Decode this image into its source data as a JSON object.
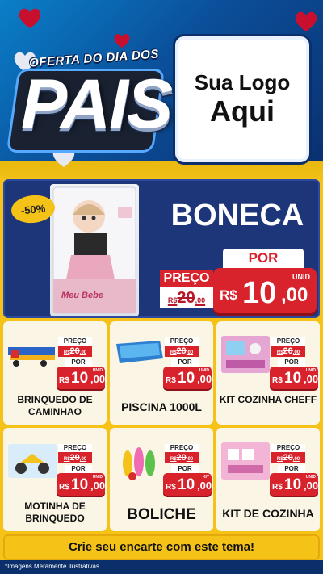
{
  "header": {
    "brand_subtitle": "OFERTA DO DIA DOS",
    "brand_main": "PAIS",
    "logo_line1": "Sua Logo",
    "logo_line2": "Aqui"
  },
  "hero": {
    "discount": "-50%",
    "product_box_text": "Meu Bebe",
    "title": "BONECA",
    "por_label": "POR",
    "preco_label": "PREÇO",
    "old_currency": "R$",
    "old_int": "20",
    "old_dec": ",00",
    "new_currency": "R$",
    "new_int": "10",
    "new_dec": ",00",
    "unit": "UNID"
  },
  "products": [
    {
      "name": "BRINQUEDO DE CAMINHAO",
      "preco_label": "PREÇO",
      "old_currency": "R$",
      "old_int": "20",
      "old_dec": ",00",
      "por_label": "POR",
      "new_currency": "R$",
      "new_int": "10",
      "new_dec": ",00",
      "unit": "UNID"
    },
    {
      "name": "PISCINA 1000L",
      "preco_label": "PREÇO",
      "old_currency": "R$",
      "old_int": "20",
      "old_dec": ",00",
      "por_label": "POR",
      "new_currency": "R$",
      "new_int": "10",
      "new_dec": ",00",
      "unit": "UNID"
    },
    {
      "name": "KIT COZINHA CHEFF",
      "preco_label": "PREÇO",
      "old_currency": "R$",
      "old_int": "20",
      "old_dec": ",00",
      "por_label": "POR",
      "new_currency": "R$",
      "new_int": "10",
      "new_dec": ",00",
      "unit": "UNID"
    },
    {
      "name": "MOTINHA DE BRINQUEDO",
      "preco_label": "PREÇO",
      "old_currency": "R$",
      "old_int": "20",
      "old_dec": ",00",
      "por_label": "POR",
      "new_currency": "R$",
      "new_int": "10",
      "new_dec": ",00",
      "unit": "UNID"
    },
    {
      "name": "BOLICHE",
      "preco_label": "PREÇO",
      "old_currency": "R$",
      "old_int": "20",
      "old_dec": ",00",
      "por_label": "POR",
      "new_currency": "R$",
      "new_int": "10",
      "new_dec": ",00",
      "unit": "KIT"
    },
    {
      "name": "KIT DE COZINHA",
      "preco_label": "PREÇO",
      "old_currency": "R$",
      "old_int": "20",
      "old_dec": ",00",
      "por_label": "POR",
      "new_currency": "R$",
      "new_int": "10",
      "new_dec": ",00",
      "unit": "UNID"
    }
  ],
  "footer": {
    "cta": "Crie seu encarte com este tema!",
    "disclaimer": "*Imagens Meramente Ilustrativas"
  },
  "colors": {
    "header_blue": "#0b4f9a",
    "hero_navy": "#1d3579",
    "price_red": "#d8222c",
    "yellow": "#f5c218",
    "heart_red": "#c8102e"
  }
}
